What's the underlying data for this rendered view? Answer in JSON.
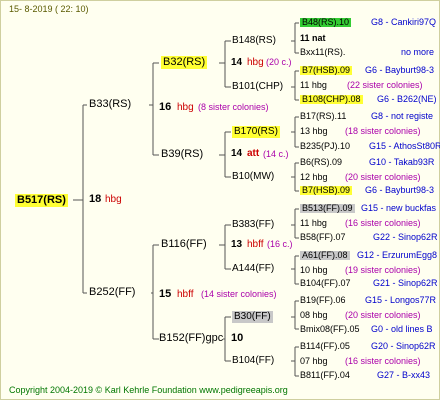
{
  "header": "15- 8-2019 ( 22: 10)",
  "root": {
    "label": "B517(RS)",
    "score": "18",
    "hbg": "hbg"
  },
  "gen1": {
    "top": {
      "label": "B33(RS)",
      "score": "16",
      "hbg": "hbg",
      "note": "(8 sister colonies)"
    },
    "bottom": {
      "label": "B252(FF)",
      "score": "15",
      "hbg": "hbff",
      "note": "(14 sister colonies)"
    }
  },
  "gen2": [
    {
      "label": "B32(RS)",
      "score": "14",
      "hbg": "hbg",
      "note": "(20 c.)"
    },
    {
      "label": "B39(RS)",
      "score": "14",
      "hbg": "att",
      "note": "(14 c.)"
    },
    {
      "label": "B116(FF)",
      "score": "13",
      "hbg": "hbff",
      "note": "(16 c.)"
    },
    {
      "label": "B152(FF)gpc",
      "score": "10",
      "hbg": "",
      "note": ""
    }
  ],
  "gen3": [
    {
      "label": "B148(RS)"
    },
    {
      "label": "B101(CHP)"
    },
    {
      "label": "B170(RS)"
    },
    {
      "label": "B10(MW)"
    },
    {
      "label": "B383(FF)"
    },
    {
      "label": "A144(FF)"
    },
    {
      "label": "B30(FF)"
    },
    {
      "label": "B104(FF)"
    }
  ],
  "gen4": [
    {
      "label": "B48(RS).10",
      "right": "G8 - Cankiri97Q"
    },
    {
      "label": "11 nat",
      "right": ""
    },
    {
      "label": "Bxx11(RS).",
      "right": "no more"
    },
    {
      "label": "B7(HSB).09",
      "right": "G6 - Bayburt98-3"
    },
    {
      "label": "11 hbg",
      "right": "(22 sister colonies)"
    },
    {
      "label": "B108(CHP).08",
      "right": "G6 - B262(NE)"
    },
    {
      "label": "B17(RS).11",
      "right": "G8 - not registe"
    },
    {
      "label": "13 hbg",
      "right": "(18 sister colonies)"
    },
    {
      "label": "B235(PJ).10",
      "right": "G15 - AthosSt80R"
    },
    {
      "label": "B6(RS).09",
      "right": "G10 - Takab93R"
    },
    {
      "label": "12 hbg",
      "right": "(20 sister colonies)"
    },
    {
      "label": "B7(HSB).09",
      "right": "G6 - Bayburt98-3"
    },
    {
      "label": "B513(FF).09",
      "right": "G15 - new buckfas"
    },
    {
      "label": "11 hbg",
      "right": "(16 sister colonies)"
    },
    {
      "label": "B58(FF).07",
      "right": "G22 - Sinop62R"
    },
    {
      "label": "A61(FF).08",
      "right": "G12 - ErzurumEgg8"
    },
    {
      "label": "10 hbg",
      "right": "(19 sister colonies)"
    },
    {
      "label": "B104(FF).07",
      "right": "G21 - Sinop62R"
    },
    {
      "label": "B19(FF).06",
      "right": "G15 - Longos77R"
    },
    {
      "label": "08 hbg",
      "right": "(20 sister colonies)"
    },
    {
      "label": "Bmix08(FF).05",
      "right": "G0 - old lines B"
    },
    {
      "label": "B114(FF).05",
      "right": "G20 - Sinop62R"
    },
    {
      "label": "07 hbg",
      "right": "(16 sister colonies)"
    },
    {
      "label": "B811(FF).04",
      "right": "G27 - B-xx43"
    }
  ],
  "footer": "Copyright 2004-2019 © Karl Kehrle Foundation   www.pedigreeapis.org"
}
